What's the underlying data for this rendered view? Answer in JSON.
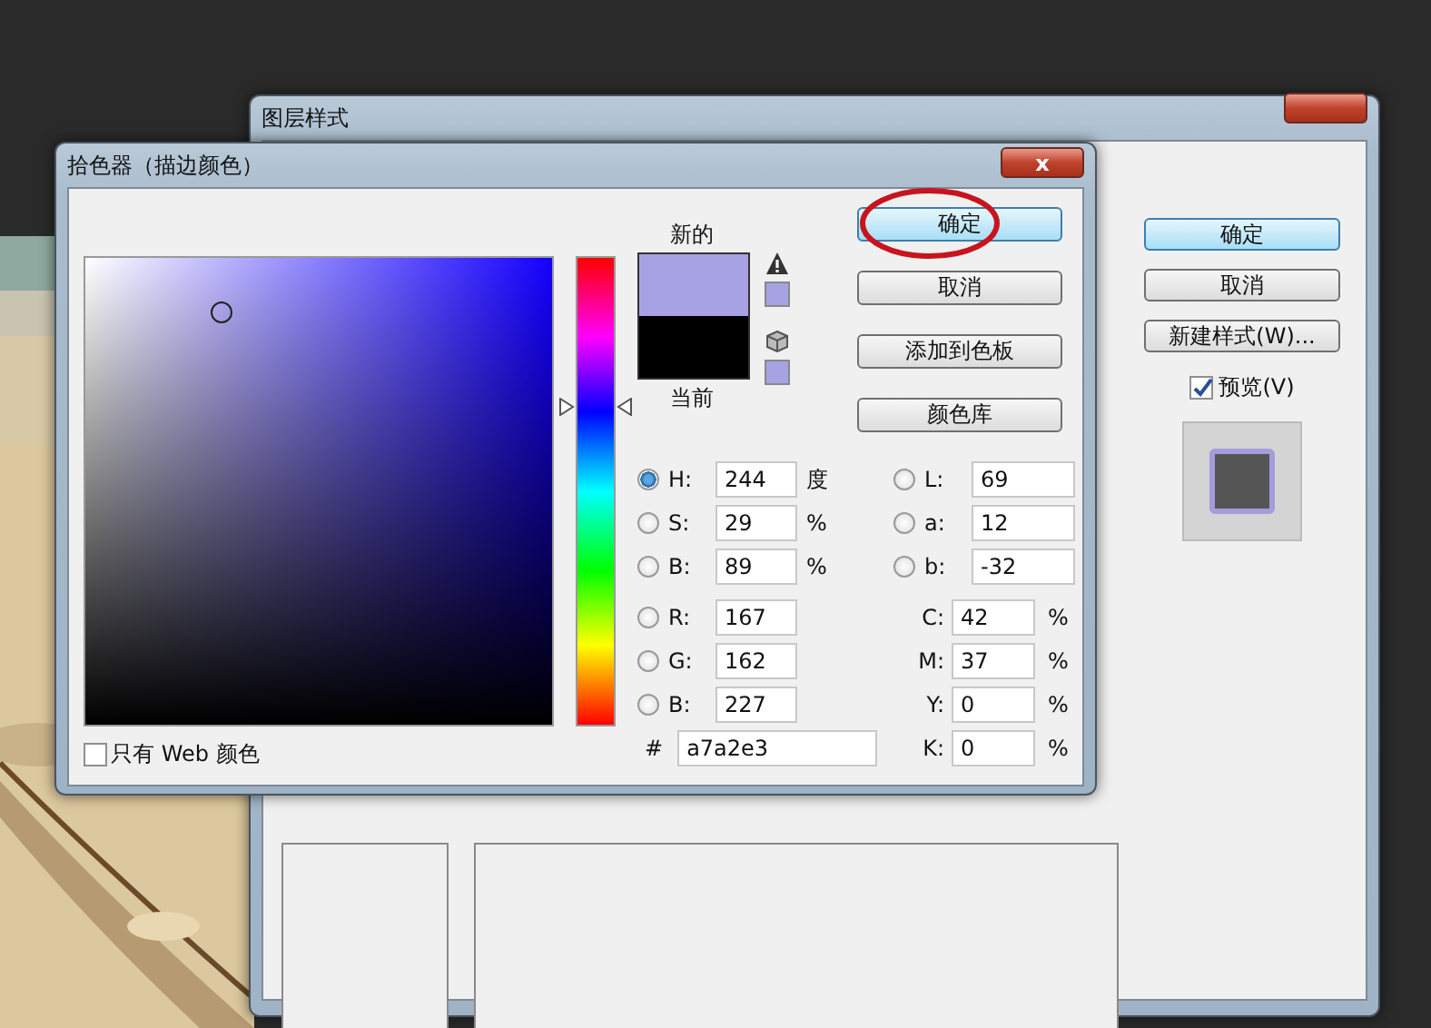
{
  "layer_style_window": {
    "title": "图层样式",
    "buttons": [
      {
        "label": "确定",
        "primary": true
      },
      {
        "label": "取消",
        "primary": false
      },
      {
        "label": "新建样式(W)...",
        "primary": false
      }
    ],
    "preview_checkbox": {
      "label": "预览(V)",
      "checked": true
    }
  },
  "color_picker": {
    "title": "拾色器（描边颜色）",
    "close": "x",
    "hue_slider": {
      "level": 0.68
    },
    "swatches": [
      {
        "label": "新的",
        "color": "#a7a2e3"
      },
      {
        "label": "当前",
        "color": "#000000"
      }
    ],
    "buttons": [
      {
        "label": "确定",
        "primary": true,
        "circled": true
      },
      {
        "label": "取消",
        "primary": false,
        "circled": false
      },
      {
        "label": "添加到色板",
        "primary": false,
        "circled": false
      },
      {
        "label": "颜色库",
        "primary": false,
        "circled": false
      }
    ],
    "hsb": [
      {
        "label": "H:",
        "value": "244",
        "unit": "度",
        "selected": true
      },
      {
        "label": "S:",
        "value": "29",
        "unit": "%",
        "selected": false
      },
      {
        "label": "B:",
        "value": "89",
        "unit": "%",
        "selected": false
      }
    ],
    "rgb": [
      {
        "label": "R:",
        "value": "167",
        "selected": false
      },
      {
        "label": "G:",
        "value": "162",
        "selected": false
      },
      {
        "label": "B:",
        "value": "227",
        "selected": false
      }
    ],
    "lab": [
      {
        "label": "L:",
        "value": "69",
        "selected": false
      },
      {
        "label": "a:",
        "value": "12",
        "selected": false
      },
      {
        "label": "b:",
        "value": "-32",
        "selected": false
      }
    ],
    "cmyk": [
      {
        "label": "C:",
        "value": "42",
        "unit": "%"
      },
      {
        "label": "M:",
        "value": "37",
        "unit": "%"
      },
      {
        "label": "Y:",
        "value": "0",
        "unit": "%"
      },
      {
        "label": "K:",
        "value": "0",
        "unit": "%"
      }
    ],
    "hex": {
      "label": "#",
      "value": "a7a2e3"
    },
    "web_only": {
      "label": "只有 Web 颜色",
      "checked": false
    }
  }
}
